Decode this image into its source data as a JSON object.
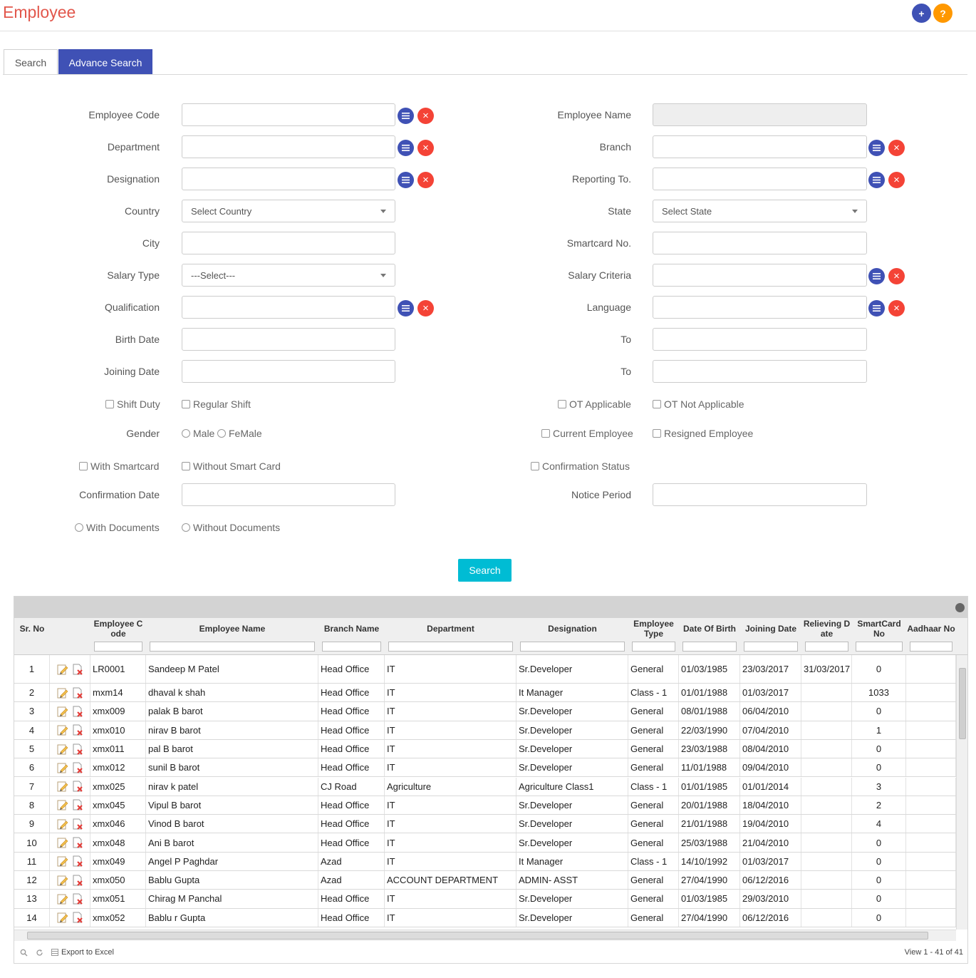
{
  "header": {
    "title": "Employee",
    "add_label": "+",
    "help_label": "?"
  },
  "tabs": [
    {
      "label": "Search"
    },
    {
      "label": "Advance Search"
    }
  ],
  "form": {
    "employee_code": "Employee Code",
    "employee_name": "Employee Name",
    "department": "Department",
    "branch": "Branch",
    "designation": "Designation",
    "reporting_to": "Reporting To.",
    "country": "Country",
    "country_value": "Select Country",
    "state": "State",
    "state_value": "Select State",
    "city": "City",
    "smartcard_no": "Smartcard No.",
    "salary_type": "Salary Type",
    "salary_type_value": "---Select---",
    "salary_criteria": "Salary Criteria",
    "qualification": "Qualification",
    "language": "Language",
    "birth_date": "Birth Date",
    "to": "To",
    "joining_date": "Joining Date",
    "shift_duty": "Shift Duty",
    "regular_shift": "Regular Shift",
    "ot_applicable": "OT Applicable",
    "ot_not_applicable": "OT Not Applicable",
    "gender": "Gender",
    "male": "Male",
    "female": "FeMale",
    "current_employee": "Current Employee",
    "resigned_employee": "Resigned Employee",
    "with_smartcard": "With Smartcard",
    "without_smart_card": "Without Smart Card",
    "confirmation_status": "Confirmation Status",
    "confirmation_date": "Confirmation Date",
    "notice_period": "Notice Period",
    "with_documents": "With Documents",
    "without_documents": "Without Documents",
    "search_label": "Search"
  },
  "grid": {
    "columns": [
      "Sr. No",
      "",
      "Employee C ode",
      "Employee Name",
      "Branch Name",
      "Department",
      "Designation",
      "Employee Type",
      "Date Of Birth",
      "Joining Date",
      "Relieving D ate",
      "SmartCard No",
      "Aadhaar No"
    ],
    "rows": [
      [
        "1",
        "LR0001",
        "Sandeep M Patel",
        "Head Office",
        "IT",
        "Sr.Developer",
        "General",
        "01/03/1985",
        "23/03/2017",
        "31/03/2017",
        "0",
        ""
      ],
      [
        "2",
        "mxm14",
        "dhaval k shah",
        "Head Office",
        "IT",
        "It Manager",
        "Class - 1",
        "01/01/1988",
        "01/03/2017",
        "",
        "1033",
        ""
      ],
      [
        "3",
        "xmx009",
        "palak B barot",
        "Head Office",
        "IT",
        "Sr.Developer",
        "General",
        "08/01/1988",
        "06/04/2010",
        "",
        "0",
        ""
      ],
      [
        "4",
        "xmx010",
        "nirav B barot",
        "Head Office",
        "IT",
        "Sr.Developer",
        "General",
        "22/03/1990",
        "07/04/2010",
        "",
        "1",
        ""
      ],
      [
        "5",
        "xmx011",
        "pal B barot",
        "Head Office",
        "IT",
        "Sr.Developer",
        "General",
        "23/03/1988",
        "08/04/2010",
        "",
        "0",
        ""
      ],
      [
        "6",
        "xmx012",
        "sunil B barot",
        "Head Office",
        "IT",
        "Sr.Developer",
        "General",
        "11/01/1988",
        "09/04/2010",
        "",
        "0",
        ""
      ],
      [
        "7",
        "xmx025",
        "nirav k patel",
        "CJ Road",
        "Agriculture",
        "Agriculture Class1",
        "Class - 1",
        "01/01/1985",
        "01/01/2014",
        "",
        "3",
        ""
      ],
      [
        "8",
        "xmx045",
        "Vipul B barot",
        "Head Office",
        "IT",
        "Sr.Developer",
        "General",
        "20/01/1988",
        "18/04/2010",
        "",
        "2",
        ""
      ],
      [
        "9",
        "xmx046",
        "Vinod B barot",
        "Head Office",
        "IT",
        "Sr.Developer",
        "General",
        "21/01/1988",
        "19/04/2010",
        "",
        "4",
        ""
      ],
      [
        "10",
        "xmx048",
        "Ani B barot",
        "Head Office",
        "IT",
        "Sr.Developer",
        "General",
        "25/03/1988",
        "21/04/2010",
        "",
        "0",
        ""
      ],
      [
        "11",
        "xmx049",
        "Angel P Paghdar",
        "Azad",
        "IT",
        "It Manager",
        "Class - 1",
        "14/10/1992",
        "01/03/2017",
        "",
        "0",
        ""
      ],
      [
        "12",
        "xmx050",
        "Bablu Gupta",
        "Azad",
        "ACCOUNT DEPARTMENT",
        "ADMIN- ASST",
        "General",
        "27/04/1990",
        "06/12/2016",
        "",
        "0",
        ""
      ],
      [
        "13",
        "xmx051",
        "Chirag M Panchal",
        "Head Office",
        "IT",
        "Sr.Developer",
        "General",
        "01/03/1985",
        "29/03/2010",
        "",
        "0",
        ""
      ],
      [
        "14",
        "xmx052",
        "Bablu r Gupta",
        "Head Office",
        "IT",
        "Sr.Developer",
        "General",
        "27/04/1990",
        "06/12/2016",
        "",
        "0",
        ""
      ]
    ],
    "export_label": "Export to Excel",
    "view_label": "View 1 - 41 of 41"
  },
  "colors": {
    "title": "#e2574c",
    "tab_active": "#3f51b5",
    "add": "#3f51b5",
    "help": "#ff9800",
    "list_btn": "#3f51b5",
    "clear_btn": "#f44336",
    "search_btn": "#00bcd4"
  },
  "icons": [
    "plus-icon",
    "question-icon",
    "list-icon",
    "close-icon",
    "edit-icon",
    "delete-icon",
    "chevron-down-icon",
    "collapse-icon",
    "search-icon",
    "refresh-icon",
    "excel-icon"
  ]
}
